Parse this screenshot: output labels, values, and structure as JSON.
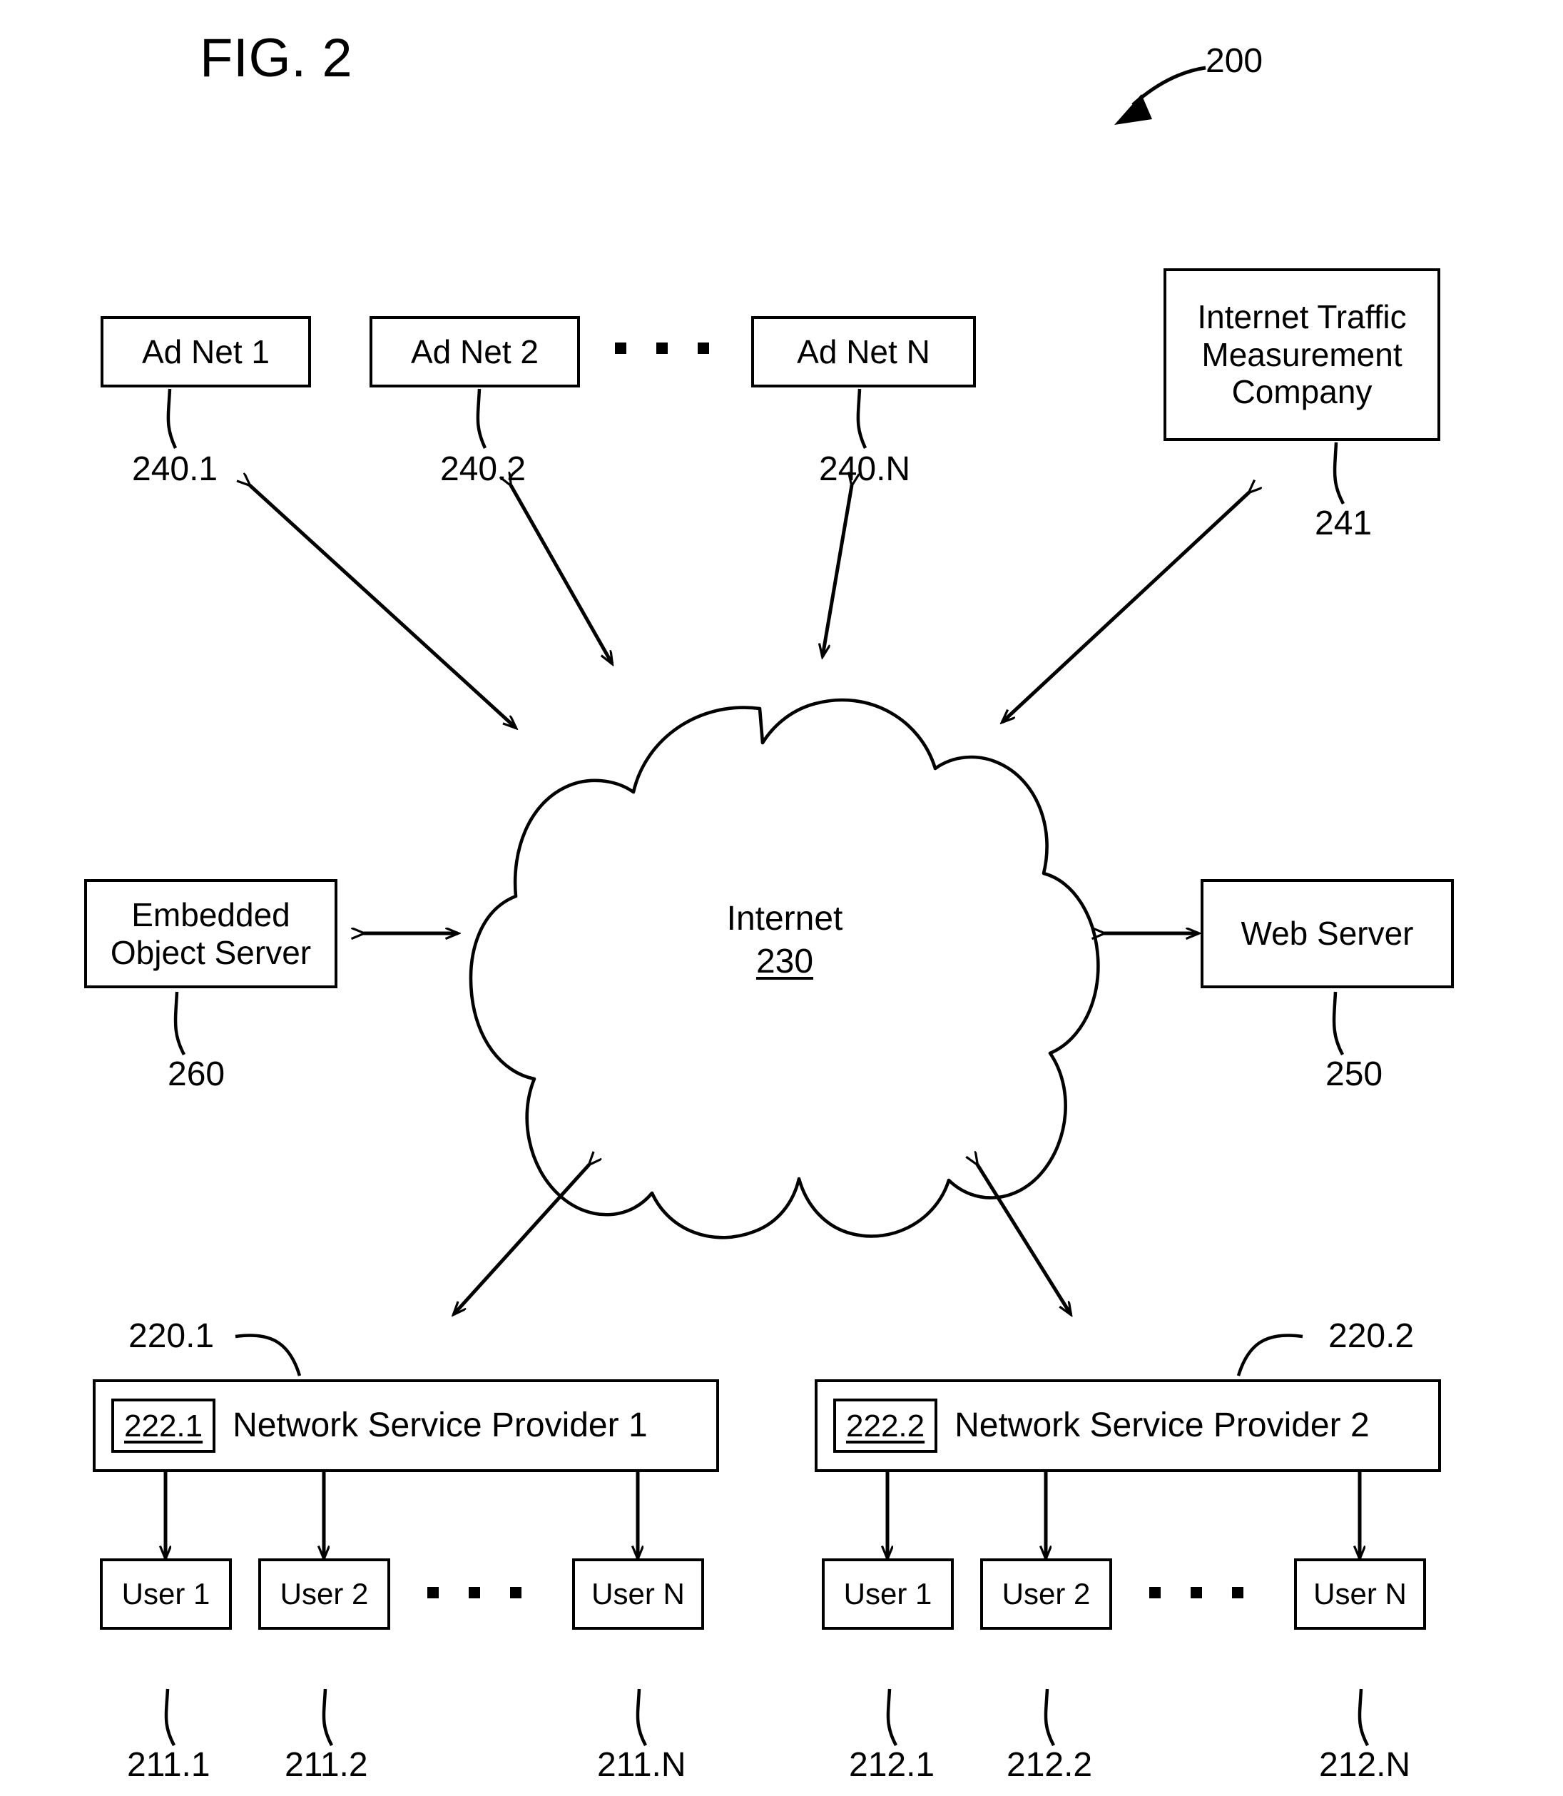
{
  "figure": {
    "title": "FIG. 2",
    "system_ref": "200"
  },
  "ad_networks": [
    {
      "label": "Ad Net 1",
      "ref": "240.1"
    },
    {
      "label": "Ad Net 2",
      "ref": "240.2"
    },
    {
      "label": "Ad Net  N",
      "ref": "240.N"
    }
  ],
  "measurement_company": {
    "line1": "Internet Traffic",
    "line2": "Measurement",
    "line3": "Company",
    "ref": "241"
  },
  "cloud": {
    "label": "Internet",
    "ref": "230"
  },
  "embedded_object_server": {
    "line1": "Embedded",
    "line2": "Object Server",
    "ref": "260"
  },
  "web_server": {
    "label": "Web Server",
    "ref": "250"
  },
  "providers": [
    {
      "ref": "220.1",
      "inner_ref": "222.1",
      "label": "Network Service Provider 1",
      "users": [
        {
          "label": "User 1",
          "ref": "211.1"
        },
        {
          "label": "User 2",
          "ref": "211.2"
        },
        {
          "label": "User N",
          "ref": "211.N"
        }
      ]
    },
    {
      "ref": "220.2",
      "inner_ref": "222.2",
      "label": "Network Service Provider 2",
      "users": [
        {
          "label": "User 1",
          "ref": "212.1"
        },
        {
          "label": "User 2",
          "ref": "212.2"
        },
        {
          "label": "User N",
          "ref": "212.N"
        }
      ]
    }
  ],
  "colors": {
    "ink": "#000000",
    "paper": "#ffffff"
  }
}
